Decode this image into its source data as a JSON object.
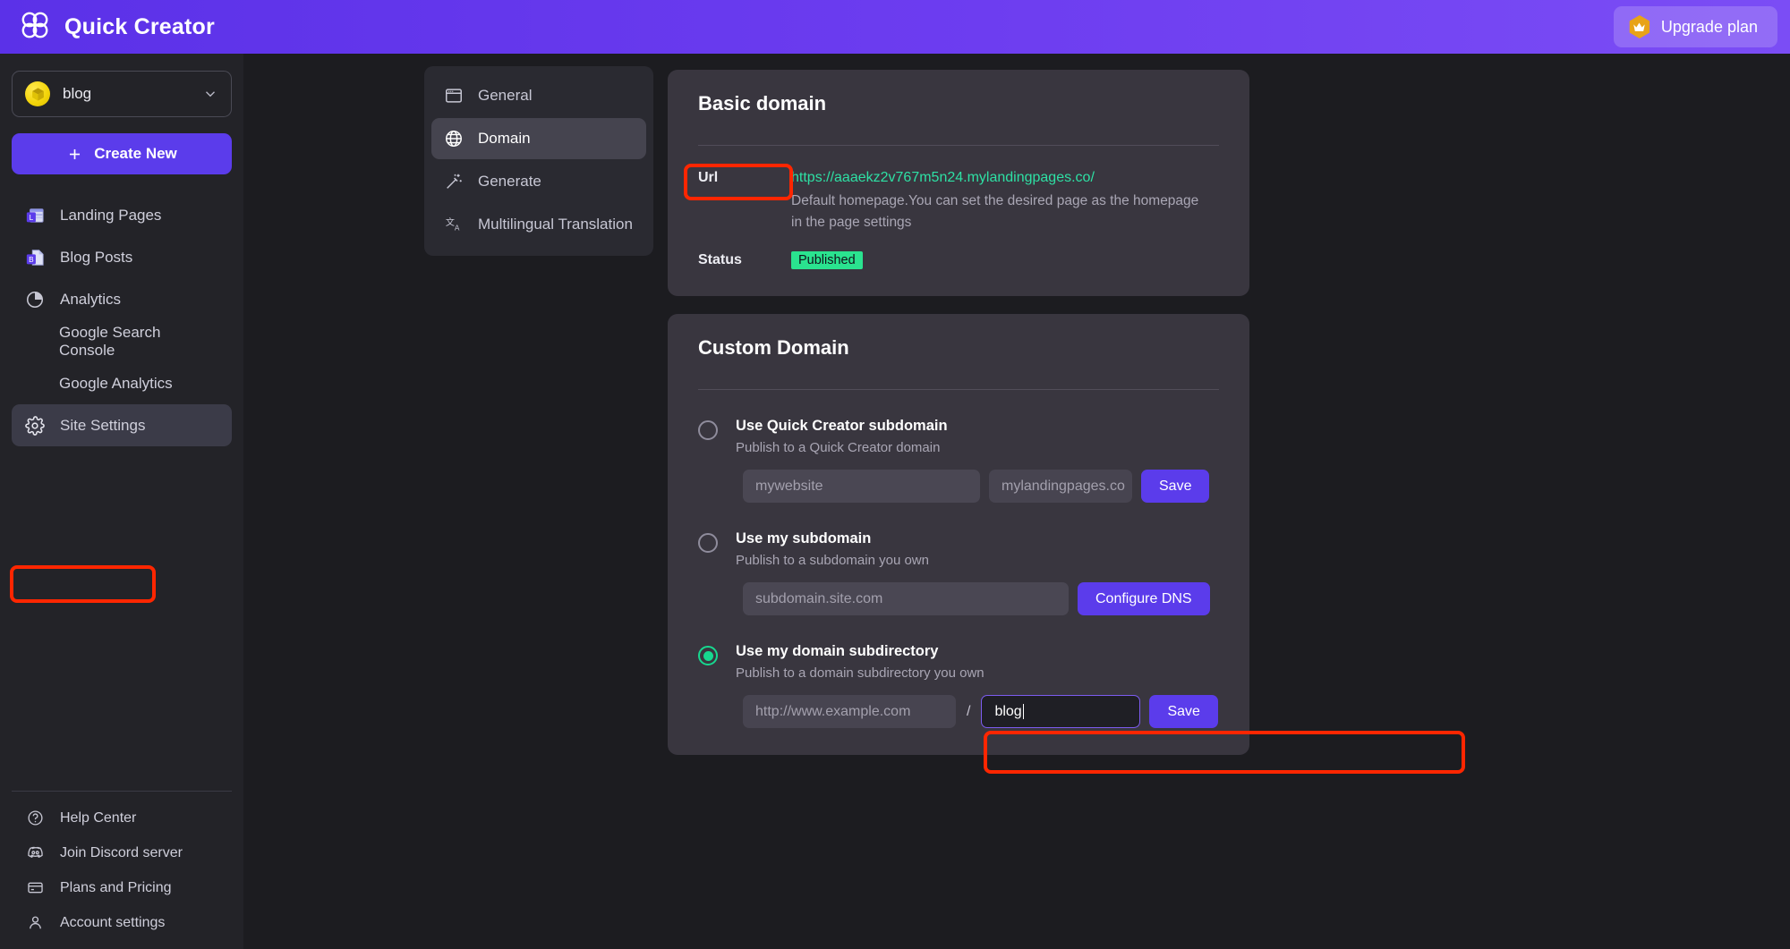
{
  "topbar": {
    "brand": "Quick Creator",
    "logo_icon": "quick-creator-logo",
    "upgrade_label": "Upgrade plan",
    "upgrade_icon": "crown-icon"
  },
  "sidebar": {
    "site_selector": {
      "name": "blog",
      "avatar_icon": "cube-icon",
      "chevron_icon": "chevron-down-icon"
    },
    "create_button": {
      "label": "Create New",
      "icon": "plus-icon"
    },
    "nav": [
      {
        "label": "Landing Pages",
        "icon": "landing-pages-icon",
        "sub": false,
        "active": false
      },
      {
        "label": "Blog Posts",
        "icon": "blog-posts-icon",
        "sub": false,
        "active": false
      },
      {
        "label": "Analytics",
        "icon": "pie-chart-icon",
        "sub": false,
        "active": false
      },
      {
        "label": "Google Search Console",
        "icon": "",
        "sub": true,
        "active": false
      },
      {
        "label": "Google Analytics",
        "icon": "",
        "sub": true,
        "active": false
      },
      {
        "label": "Site Settings",
        "icon": "gear-icon",
        "sub": false,
        "active": true
      }
    ],
    "bottom_nav": [
      {
        "label": "Help Center",
        "icon": "question-circle-icon"
      },
      {
        "label": "Join Discord server",
        "icon": "discord-icon"
      },
      {
        "label": "Plans and Pricing",
        "icon": "credit-card-icon"
      },
      {
        "label": "Account settings",
        "icon": "user-icon"
      }
    ]
  },
  "settings_menu": [
    {
      "label": "General",
      "icon": "window-icon",
      "active": false
    },
    {
      "label": "Domain",
      "icon": "globe-icon",
      "active": true
    },
    {
      "label": "Generate",
      "icon": "magic-wand-icon",
      "active": false
    },
    {
      "label": "Multilingual Translation",
      "icon": "translate-icon",
      "active": false
    }
  ],
  "basic_domain": {
    "title": "Basic domain",
    "url_label": "Url",
    "url": "https://aaaekz2v767m5n24.mylandingpages.co/",
    "url_help": "Default homepage.You can set the desired page as the homepage in the page settings",
    "status_label": "Status",
    "status_value": "Published"
  },
  "custom_domain": {
    "title": "Custom Domain",
    "options": [
      {
        "title": "Use Quick Creator subdomain",
        "subtitle": "Publish to a Quick Creator domain",
        "selected": false,
        "input_placeholder": "mywebsite",
        "suffix_text": "mylandingpages.co",
        "button_label": "Save"
      },
      {
        "title": "Use my subdomain",
        "subtitle": "Publish to a subdomain you own",
        "selected": false,
        "input_placeholder": "subdomain.site.com",
        "button_label": "Configure DNS"
      },
      {
        "title": "Use my domain subdirectory",
        "subtitle": "Publish to a domain subdirectory you own",
        "selected": true,
        "domain_value": "http://www.example.com",
        "separator": "/",
        "path_value": "blog",
        "button_label": "Save"
      }
    ]
  },
  "colors": {
    "brand_purple": "#5b3ceb",
    "accent_green": "#2ee0a4",
    "status_green": "#2ae38f",
    "annotation_red": "#ff2600",
    "focus_border": "#7c5cf0"
  }
}
